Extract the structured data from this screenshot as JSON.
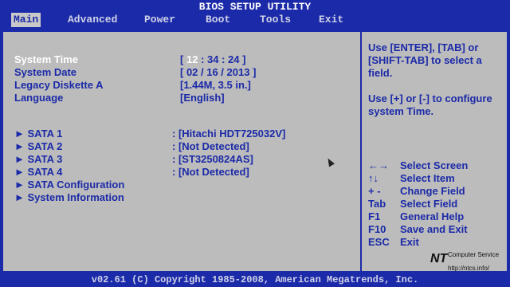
{
  "window": {
    "title": "BIOS SETUP UTILITY"
  },
  "menu": {
    "items": [
      {
        "label": "Main",
        "active": true
      },
      {
        "label": "Advanced"
      },
      {
        "label": "Power"
      },
      {
        "label": "Boot"
      },
      {
        "label": "Tools"
      },
      {
        "label": "Exit"
      }
    ]
  },
  "main": {
    "rows": [
      {
        "label": "System Time",
        "value_prefix": "[",
        "value_sel": "12",
        "value_rest": " : 34 : 24 ]"
      },
      {
        "label": "System Date",
        "value": "[ 02 / 16 / 2013 ]"
      },
      {
        "label": "Legacy Diskette A",
        "value": "[1.44M, 3.5 in.]"
      },
      {
        "label": "Language",
        "value": "[English]"
      }
    ],
    "sata": [
      {
        "label": "SATA 1",
        "value": ": [Hitachi HDT725032V]"
      },
      {
        "label": "SATA 2",
        "value": ": [Not Detected]"
      },
      {
        "label": "SATA 3",
        "value": ": [ST3250824AS]"
      },
      {
        "label": "SATA 4",
        "value": ": [Not Detected]"
      }
    ],
    "submenus": [
      {
        "label": "SATA Configuration"
      },
      {
        "label": "System Information"
      }
    ],
    "arrow": "►"
  },
  "help": {
    "text1": "Use [ENTER], [TAB] or [SHIFT-TAB] to select a field.",
    "text2": "Use [+] or [-] to configure system Time.",
    "legend": [
      {
        "key": "←→",
        "desc": "Select Screen"
      },
      {
        "key": "↑↓",
        "desc": "Select Item"
      },
      {
        "key": "+ -",
        "desc": "Change Field"
      },
      {
        "key": "Tab",
        "desc": "Select Field"
      },
      {
        "key": "F1",
        "desc": "General Help"
      },
      {
        "key": "F10",
        "desc": "Save and Exit"
      },
      {
        "key": "ESC",
        "desc": "Exit"
      }
    ]
  },
  "footer": {
    "copyright": "v02.61 (C) Copyright 1985-2008, American Megatrends, Inc."
  },
  "watermark": {
    "brand": "NT",
    "tagline": "Computer Service",
    "url": "http://ntcs.info/"
  }
}
